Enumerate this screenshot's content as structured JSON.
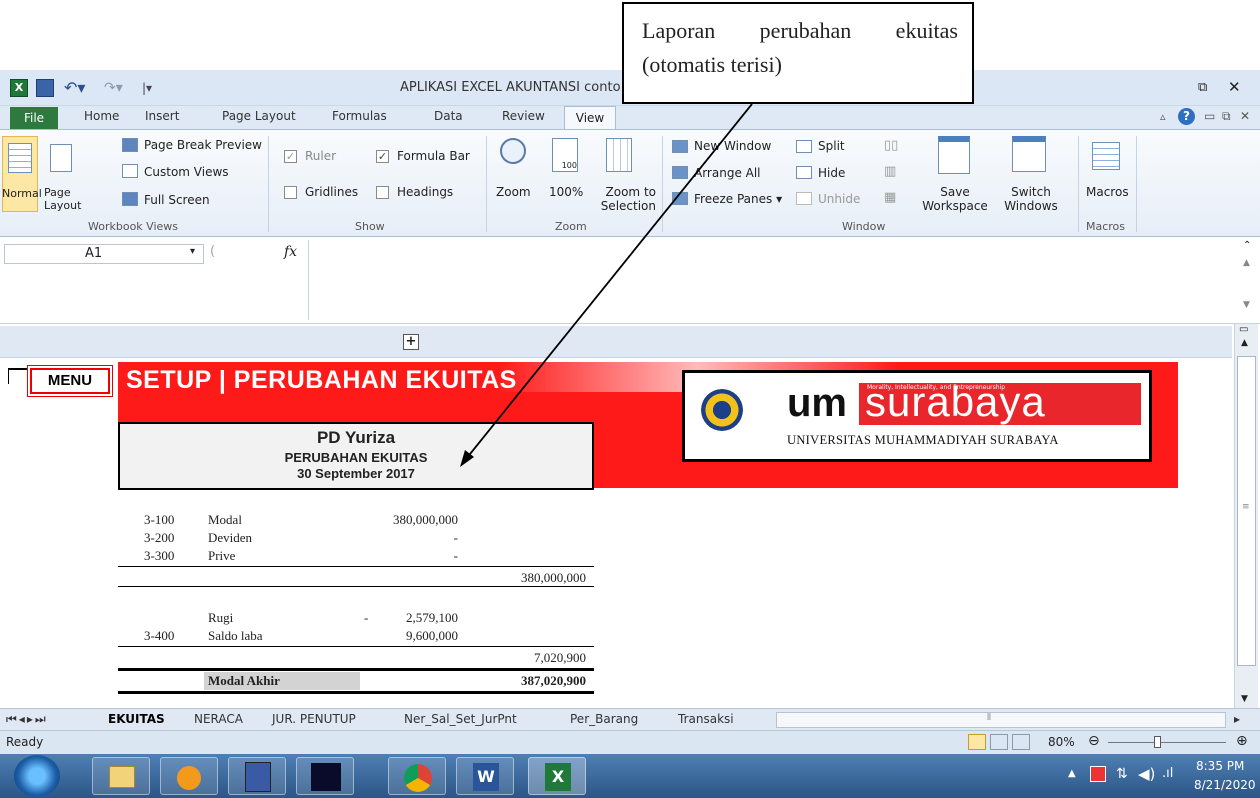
{
  "window": {
    "title": "APLIKASI EXCEL AKUNTANSI conto"
  },
  "callout": {
    "text": "Laporan perubahan ekuitas (otomatis terisi)"
  },
  "ribbon": {
    "tabs": [
      "File",
      "Home",
      "Insert",
      "Page Layout",
      "Formulas",
      "Data",
      "Review",
      "View"
    ],
    "active_tab": "View",
    "workbook_views": {
      "normal": "Normal",
      "page_layout": "Page Layout",
      "page_break_preview": "Page Break Preview",
      "custom_views": "Custom Views",
      "full_screen": "Full Screen",
      "group": "Workbook Views"
    },
    "show": {
      "ruler": "Ruler",
      "formula_bar": "Formula Bar",
      "gridlines": "Gridlines",
      "headings": "Headings",
      "group": "Show",
      "ruler_checked": true,
      "formula_bar_checked": true,
      "gridlines_checked": false,
      "headings_checked": false
    },
    "zoom": {
      "zoom": "Zoom",
      "zoom100": "100%",
      "zoom_to_selection": "Zoom to Selection",
      "group": "Zoom"
    },
    "window": {
      "new_window": "New Window",
      "arrange_all": "Arrange All",
      "freeze_panes": "Freeze Panes",
      "split": "Split",
      "hide": "Hide",
      "unhide": "Unhide",
      "save_workspace": "Save Workspace",
      "switch_windows": "Switch Windows",
      "group": "Window"
    },
    "macros": {
      "macros": "Macros",
      "group": "Macros"
    }
  },
  "formula_bar": {
    "name_box": "A1",
    "fx": "fx",
    "value": ""
  },
  "sheet": {
    "menu_button": "MENU",
    "setup_title": "SETUP | PERUBAHAN EKUITAS",
    "company": "PD Yuriza",
    "report_title": "PERUBAHAN EKUITAS",
    "report_date": "30 September 2017",
    "logo": {
      "um": "um",
      "surabaya": "surabaya",
      "tagline": "Morality, Intellectuality, and Entrepreneurship",
      "university": "UNIVERSITAS MUHAMMADIYAH SURABAYA"
    },
    "rows": [
      {
        "code": "3-100",
        "name": "Modal",
        "amount": "380,000,000"
      },
      {
        "code": "3-200",
        "name": "Deviden",
        "amount": "-"
      },
      {
        "code": "3-300",
        "name": "Prive",
        "amount": "-"
      }
    ],
    "subtotal1": "380,000,000",
    "rugi": {
      "name": "Rugi",
      "sign": "-",
      "amount": "2,579,100"
    },
    "saldo_laba": {
      "code": "3-400",
      "name": "Saldo laba",
      "amount": "9,600,000"
    },
    "subtotal2": "7,020,900",
    "modal_akhir": {
      "name": "Modal Akhir",
      "amount": "387,020,900"
    }
  },
  "sheet_tabs": [
    "EKUITAS",
    "NERACA",
    "JUR. PENUTUP",
    "Ner_Sal_Set_JurPnt",
    "Per_Barang",
    "Transaksi"
  ],
  "active_sheet": "EKUITAS",
  "status": {
    "ready": "Ready",
    "zoom": "80%"
  },
  "taskbar": {
    "time": "8:35 PM",
    "date": "8/21/2020"
  }
}
